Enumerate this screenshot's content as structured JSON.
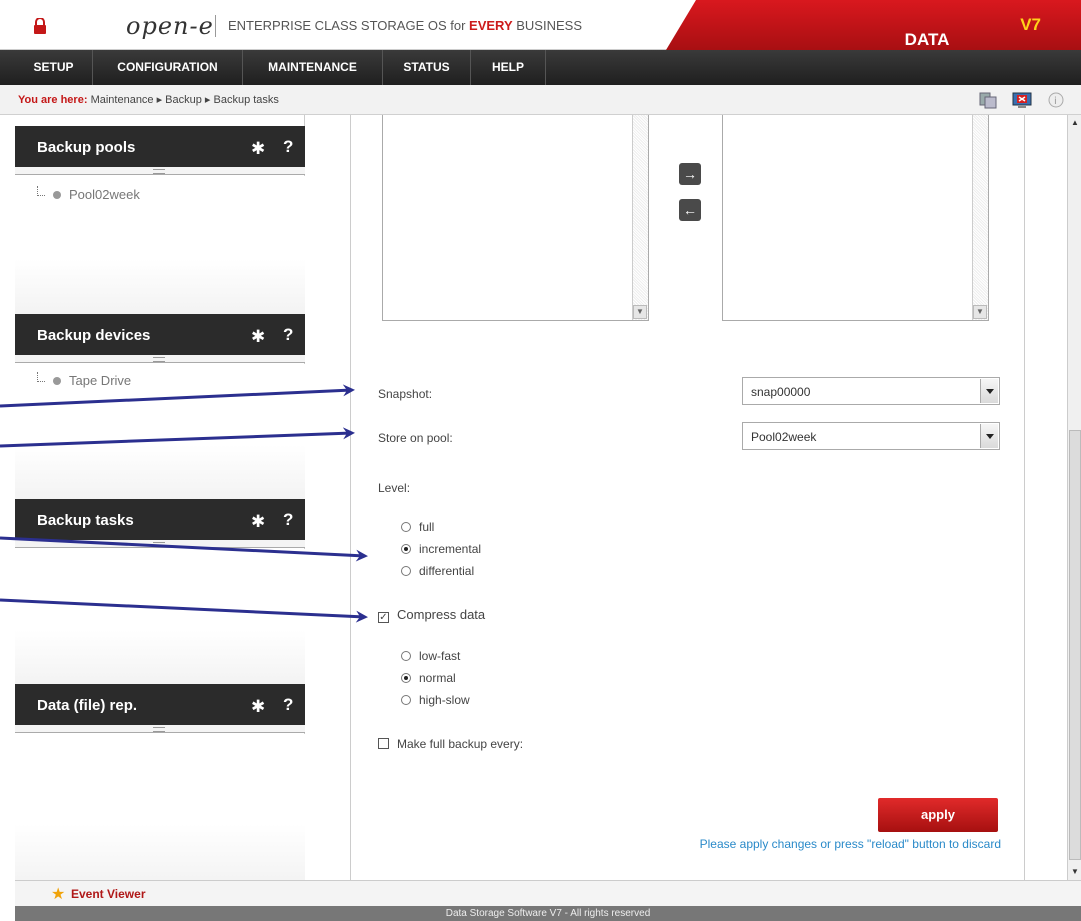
{
  "header": {
    "logo": "open-e",
    "tagline_pre": "ENTERPRISE CLASS STORAGE OS for ",
    "tagline_hl": "EVERY",
    "tagline_post": " BUSINESS",
    "brand": "DATA STORAGE SOFTWARE ",
    "brand_version": "V7"
  },
  "nav": [
    "SETUP",
    "CONFIGURATION",
    "MAINTENANCE",
    "STATUS",
    "HELP"
  ],
  "breadcrumb": {
    "lead": "You are here:",
    "path": "Maintenance ▸ Backup ▸ Backup tasks"
  },
  "panels": [
    {
      "title": "Backup pools",
      "items": [
        "Pool02week"
      ]
    },
    {
      "title": "Backup devices",
      "items": [
        "Tape Drive"
      ]
    },
    {
      "title": "Backup tasks",
      "items": []
    },
    {
      "title": "Data (file) rep.",
      "items": []
    }
  ],
  "form": {
    "snapshot_label": "Snapshot:",
    "snapshot_value": "snap00000",
    "pool_label": "Store on pool:",
    "pool_value": "Pool02week",
    "level_label": "Level:",
    "level_options": [
      "full",
      "incremental",
      "differential"
    ],
    "level_selected": "incremental",
    "compress_label": "Compress data",
    "compress_checked": true,
    "compress_options": [
      "low-fast",
      "normal",
      "high-slow"
    ],
    "compress_selected": "normal",
    "fullbackup_label": "Make full backup every:",
    "fullbackup_checked": false,
    "apply_label": "apply",
    "apply_note": "Please apply changes or press \"reload\" button to discard"
  },
  "event_viewer": "Event Viewer",
  "footer": "Data Storage Software V7 - All rights reserved",
  "colors": {
    "brand_red": "#c41818",
    "dark": "#2b2b2b",
    "link_blue": "#2a8ac9",
    "annotation_arrow": "#2b2f8f"
  },
  "icons": [
    "lock-icon",
    "gear-icon",
    "help-icon",
    "arrow-right-icon",
    "arrow-left-icon",
    "star-icon",
    "dropdown-arrow-icon"
  ]
}
